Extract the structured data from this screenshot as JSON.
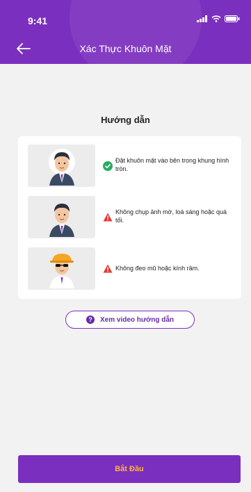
{
  "status_bar": {
    "time": "9:41"
  },
  "header": {
    "title": "Xác Thực Khuôn Mặt",
    "back_icon": "arrow-left-icon"
  },
  "guide": {
    "heading": "Hướng dẫn",
    "items": [
      {
        "text": "Đặt khuôn mặt vào bên trong khung hình tròn.",
        "status": "check",
        "status_color": "#27ae60",
        "avatar": "face-normal"
      },
      {
        "text": "Không chụp ảnh mờ, loá sáng hoặc quá tối.",
        "status": "warning",
        "status_color": "#e53935",
        "avatar": "face-blurry"
      },
      {
        "text": "Không đeo mũ hoặc kính râm.",
        "status": "warning",
        "status_color": "#e53935",
        "avatar": "face-hat-sunglasses"
      }
    ]
  },
  "video_button": {
    "label": "Xem video hướng dẫn",
    "icon": "help-circle-icon"
  },
  "start_button": {
    "label": "Bắt Đầu"
  },
  "colors": {
    "primary": "#7b2fbe",
    "accent": "#ffb733",
    "background": "#f2f2f2"
  }
}
